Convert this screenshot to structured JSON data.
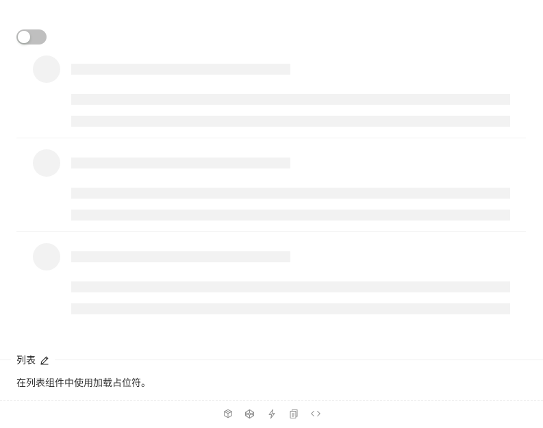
{
  "demo": {
    "toggle_on": false,
    "list_item_count": 3
  },
  "meta": {
    "title": "列表",
    "description": "在列表组件中使用加载占位符。"
  },
  "icons": {
    "edit": "edit-icon",
    "actions": [
      "codesandbox-icon",
      "codepen-icon",
      "stackblitz-icon",
      "copy-code-icon",
      "expand-code-icon"
    ]
  },
  "colors": {
    "skeleton": "#f2f2f2",
    "toggle_off": "#bfbfbf",
    "divider": "#f0f0f0",
    "icon": "#8c8c8c"
  }
}
